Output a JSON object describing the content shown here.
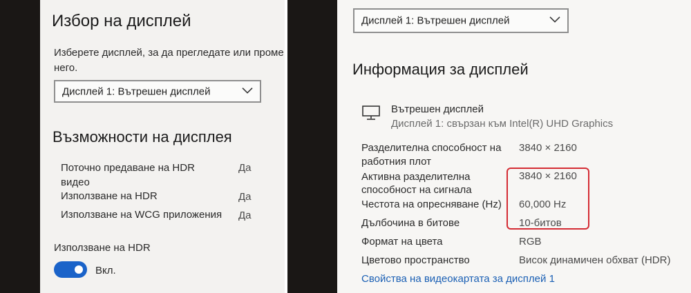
{
  "left": {
    "title": "Избор на дисплей",
    "description_line1": "Изберете дисплей, за да прегледате или проме",
    "description_line2": "него.",
    "dropdown_value": "Дисплей 1: Вътрешен дисплей",
    "capabilities_title": "Възможности на дисплея",
    "capabilities": [
      {
        "label_line1": "Поточно предаване на HDR",
        "label_line2": "видео",
        "value": "Да"
      },
      {
        "label_line1": "Използване на HDR",
        "label_line2": "",
        "value": "Да"
      },
      {
        "label_line1": "Използване на WCG приложения",
        "label_line2": "",
        "value": "Да"
      }
    ],
    "hdr_toggle_label": "Използване на HDR",
    "hdr_toggle_state": "Вкл."
  },
  "right": {
    "dropdown_value": "Дисплей 1: Вътрешен дисплей",
    "title": "Информация за дисплей",
    "monitor_name": "Вътрешен дисплей",
    "monitor_subtitle": "Дисплей 1: свързан към Intel(R) UHD Graphics",
    "rows": [
      {
        "label_line1": "Разделителна способност на",
        "label_line2": "работния плот",
        "value": "3840 × 2160"
      },
      {
        "label_line1": "Активна разделителна",
        "label_line2": "способност на сигнала",
        "value": "3840 × 2160"
      },
      {
        "label_line1": "Честота на опресняване (Hz)",
        "label_line2": "",
        "value": "60,000 Hz"
      },
      {
        "label_line1": "Дълбочина в битове",
        "label_line2": "",
        "value": "10-битов"
      },
      {
        "label_line1": "Формат на цвета",
        "label_line2": "",
        "value": "RGB"
      },
      {
        "label_line1": "Цветово пространство",
        "label_line2": "",
        "value": "Висок динамичен обхват (HDR)"
      }
    ],
    "adapter_link": "Свойства на видеокартата за дисплей 1"
  },
  "colors": {
    "accent": "#1a63c9",
    "link": "#1a5fb4",
    "highlight": "#d42b33"
  },
  "icons": {
    "dropdown_chevron": "chevron-down-icon",
    "monitor": "monitor-icon"
  }
}
